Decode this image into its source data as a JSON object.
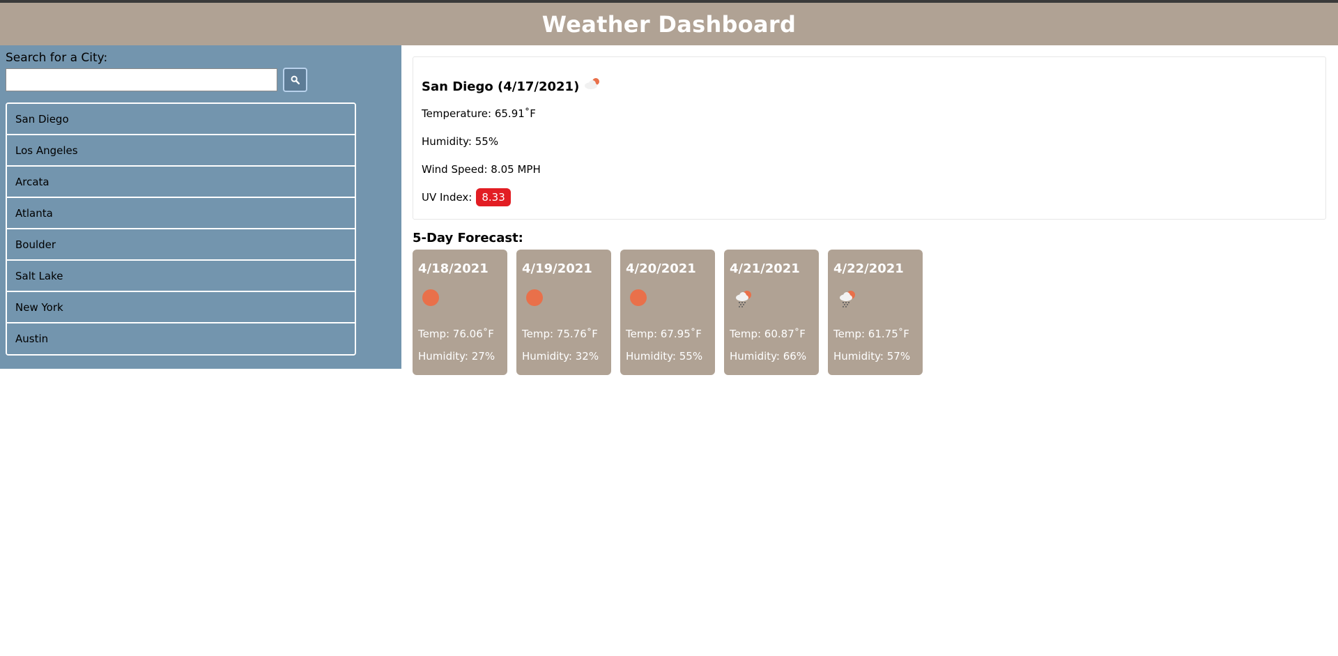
{
  "header": {
    "title": "Weather Dashboard"
  },
  "sidebar": {
    "search_label": "Search for a City:",
    "search_value": "",
    "search_icon": "search-icon",
    "cities": [
      "San Diego",
      "Los Angeles",
      "Arcata",
      "Atlanta",
      "Boulder",
      "Salt Lake",
      "New York",
      "Austin"
    ]
  },
  "current": {
    "title": "San Diego (4/17/2021)",
    "icon": "partly-cloudy-icon",
    "temperature": "Temperature: 65.91˚F",
    "humidity": "Humidity: 55%",
    "wind": "Wind Speed: 8.05 MPH",
    "uv_label": "UV Index:",
    "uv_value": "8.33",
    "uv_color": "#e21d23"
  },
  "forecast": {
    "heading": "5-Day Forecast:",
    "days": [
      {
        "date": "4/18/2021",
        "icon": "sun-icon",
        "temp": "Temp: 76.06˚F",
        "humidity": "Humidity: 27%"
      },
      {
        "date": "4/19/2021",
        "icon": "sun-icon",
        "temp": "Temp: 75.76˚F",
        "humidity": "Humidity: 32%"
      },
      {
        "date": "4/20/2021",
        "icon": "sun-icon",
        "temp": "Temp: 67.95˚F",
        "humidity": "Humidity: 55%"
      },
      {
        "date": "4/21/2021",
        "icon": "rain-cloud-icon",
        "temp": "Temp: 60.87˚F",
        "humidity": "Humidity: 66%"
      },
      {
        "date": "4/22/2021",
        "icon": "rain-cloud-icon",
        "temp": "Temp: 61.75˚F",
        "humidity": "Humidity: 57%"
      }
    ]
  },
  "colors": {
    "header_bg": "#b0a294",
    "sidebar_bg": "#7395ae",
    "card_bg": "#b0a294",
    "sun": "#e9704a"
  }
}
